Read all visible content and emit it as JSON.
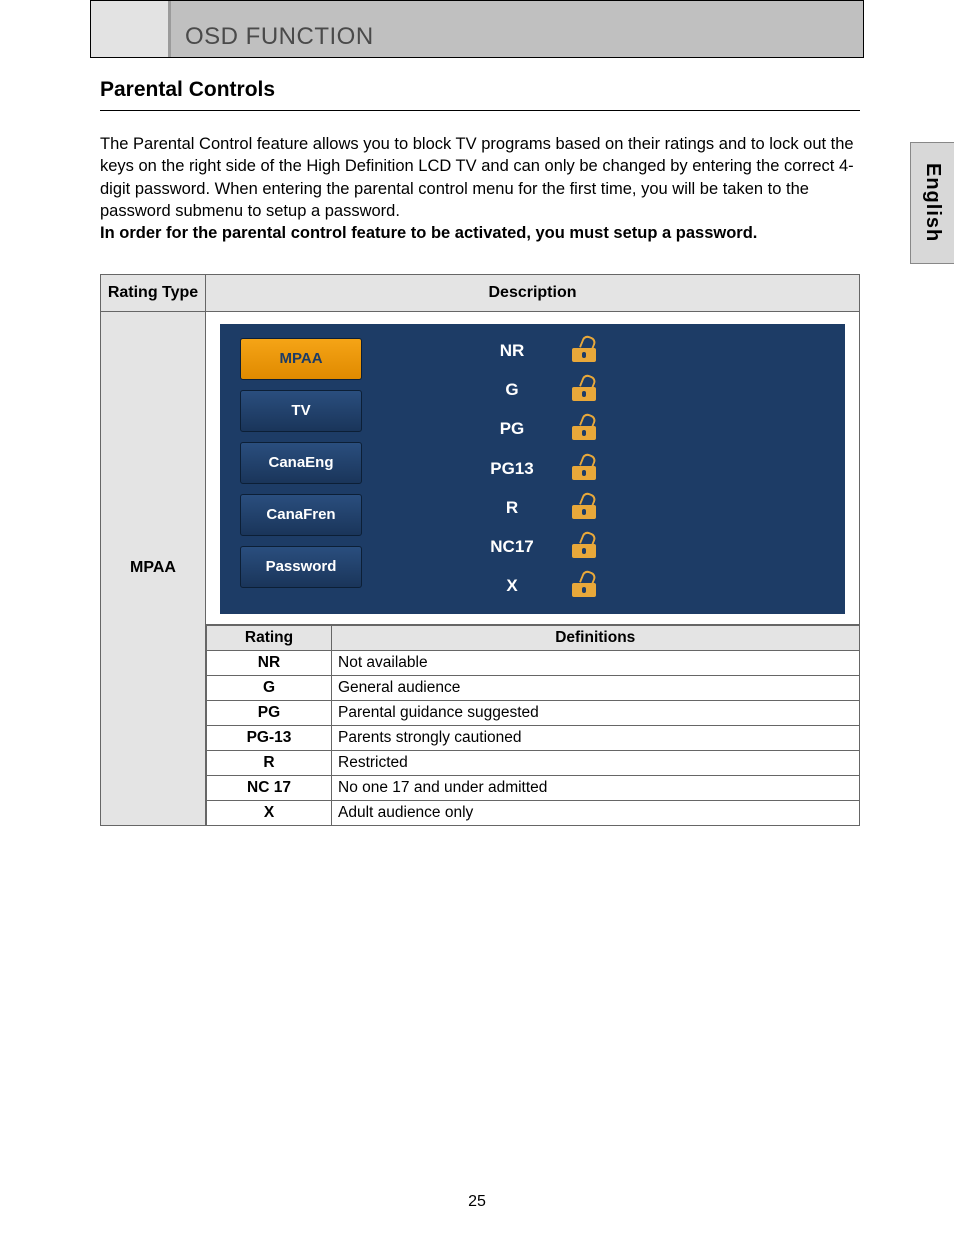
{
  "header": {
    "title": "OSD FUNCTION"
  },
  "sideTab": "English",
  "section": {
    "title": "Parental Controls",
    "intro_plain": "The Parental Control feature allows you to block TV programs based on their ratings and to lock out the keys on the right side of the High Definition LCD TV and can only be changed by entering the correct 4-digit password. When entering the parental control menu for the first time, you will be taken to the password submenu to setup a password.",
    "intro_bold": "In order for the parental control feature to be activated, you must setup a password."
  },
  "table": {
    "col1": "Rating Type",
    "col2": "Description",
    "rowLabel": "MPAA",
    "defsHeader": {
      "rating": "Rating",
      "definitions": "Definitions"
    }
  },
  "osd": {
    "menu": [
      "MPAA",
      "TV",
      "CanaEng",
      "CanaFren",
      "Password"
    ],
    "ratings": [
      "NR",
      "G",
      "PG",
      "PG13",
      "R",
      "NC17",
      "X"
    ]
  },
  "definitions": [
    {
      "code": "NR",
      "text": "Not available"
    },
    {
      "code": "G",
      "text": "General audience"
    },
    {
      "code": "PG",
      "text": "Parental guidance suggested"
    },
    {
      "code": "PG-13",
      "text": "Parents strongly cautioned"
    },
    {
      "code": "R",
      "text": "Restricted"
    },
    {
      "code": "NC 17",
      "text": "No one 17 and under admitted"
    },
    {
      "code": "X",
      "text": "Adult audience only"
    }
  ],
  "pageNumber": "25"
}
